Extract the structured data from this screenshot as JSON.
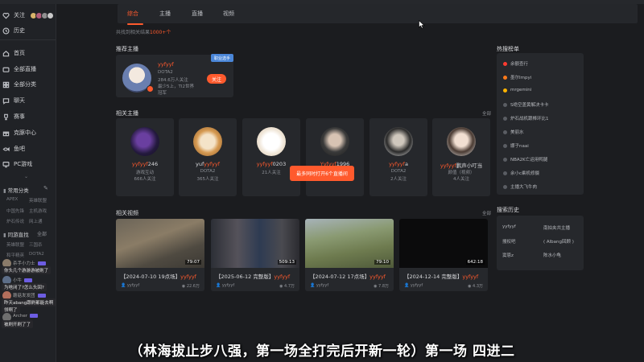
{
  "sidebar": {
    "nav": [
      {
        "label": "关注",
        "icon": "heart-icon"
      },
      {
        "label": "历史",
        "icon": "clock-icon"
      },
      {
        "label": "首页",
        "icon": "home-icon"
      },
      {
        "label": "全部直播",
        "icon": "tv-icon"
      },
      {
        "label": "全部分类",
        "icon": "grid-icon"
      },
      {
        "label": "聊天",
        "icon": "chat-icon"
      },
      {
        "label": "赛事",
        "icon": "trophy-icon"
      },
      {
        "label": "克豚中心",
        "icon": "gift-icon"
      },
      {
        "label": "鱼吧",
        "icon": "fish-icon"
      },
      {
        "label": "PC游戏",
        "icon": "monitor-icon"
      }
    ],
    "common_category_title": "常用分类",
    "common_categories": [
      "APEX",
      "英雄联盟",
      "中国先锋",
      "主机游戏",
      "炉石传说",
      "网上通"
    ],
    "same_category_title": "同游直找",
    "same_category_all": "全部",
    "same_categories": [
      "英雄联盟",
      "三国杀",
      "和平精英",
      "DOTA2",
      "绝地求生",
      "APEX"
    ],
    "chat": [
      {
        "name": "杀手小力士",
        "text": "你头几个游游游被刷了"
      },
      {
        "name": "小牛",
        "text": "路路国了"
      },
      {
        "name": "",
        "text": "为啥闭了?怎么头回?"
      },
      {
        "name": "蘑菇发发团",
        "text": "昨天abang跟刷都能去啊"
      },
      {
        "name": "",
        "text": "领啊了"
      },
      {
        "name": "Archer",
        "text": "被刷开刷了了"
      }
    ]
  },
  "tabs": {
    "items": [
      "综合",
      "主播",
      "直播",
      "视频"
    ],
    "active": "综合"
  },
  "result_count": {
    "prefix": "共找到相关结果",
    "count": "1000+",
    "suffix": "个"
  },
  "recommend": {
    "title": "推荐主播",
    "name": "yyfyyf",
    "category": "DOTA2",
    "fans": "284.6万人关注",
    "desc_1": "最少5上，TI2世界",
    "desc_2": "冠军",
    "tag": "职业选手",
    "follow_label": "关注"
  },
  "related_anchors": {
    "title": "相关主播",
    "all": "全部",
    "overlay": "最多同时打开6个直播间",
    "items": [
      {
        "name_hl": "yyfyyf",
        "name_rest": "246",
        "sub1": "游戏互动",
        "sub2": "666人关注"
      },
      {
        "name_pre": "yuf",
        "name_hl": "yyfyyf",
        "sub1": "DOTA2",
        "sub2": "365人关注"
      },
      {
        "name_hl": "yyfyyf",
        "name_rest": "0203",
        "sub1": "21人关注",
        "sub2": ""
      },
      {
        "name_hl": "Yyfyyf",
        "name_rest": "1996",
        "sub1": "",
        "sub2": ""
      },
      {
        "name_hl": "yyfyyf",
        "name_rest": "a",
        "sub1": "DOTA2",
        "sub2": "2人关注"
      },
      {
        "name_hl": "yyfyyf",
        "name_rest": "鹏声小叮当",
        "sub1": "颜值（视频）",
        "sub2": "4人关注"
      }
    ]
  },
  "related_videos": {
    "title": "相关视频",
    "all": "全部",
    "items": [
      {
        "title_pre": "【2024-07-10 19点场】",
        "title_hl": "yyfyyf",
        "author": "yyfyyf",
        "views": "22.6万",
        "duration": "79:07"
      },
      {
        "title_pre": "【2025-06-12 完整版】",
        "title_hl": "yyfyyf",
        "author": "yyfyyf",
        "views": "4.7万",
        "duration": "509:13"
      },
      {
        "title_pre": "【2024-07-12 17点场】",
        "title_hl": "yyfyyf",
        "author": "yyfyyf",
        "views": "7.8万",
        "duration": "79:10"
      },
      {
        "title_pre": "【2024-12-14 完整版】",
        "title_hl": "yyfyyf",
        "author": "yyfyyf",
        "views": "4.3万",
        "duration": "642:18"
      }
    ]
  },
  "hot_list": {
    "title": "热搜榜单",
    "items": [
      {
        "label": "余额查行",
        "color": "#ff3b30"
      },
      {
        "label": "墨尔Impyi",
        "color": "#ff7a1a"
      },
      {
        "label": "mrgemini",
        "color": "#ffb400"
      },
      {
        "label": "S绝空盖黄解决卡卡",
        "color": "#5a5d63"
      },
      {
        "label": "炉石战机跟棒环比1",
        "color": "#5a5d63"
      },
      {
        "label": "美丽水",
        "color": "#5a5d63"
      },
      {
        "label": "娜子naai",
        "color": "#5a5d63"
      },
      {
        "label": "NBA2K亡运用鸭腿",
        "color": "#5a5d63"
      },
      {
        "label": "余小c乘机修摄",
        "color": "#5a5d63"
      },
      {
        "label": "主播大飞牛肉",
        "color": "#5a5d63"
      }
    ]
  },
  "search_history": {
    "title": "搜索历史",
    "items": [
      "yyfyyf",
      "南拍夹共主播",
      "搜权吧",
      "( Albang回顾 )",
      "窦恩z",
      "陈水小龟"
    ]
  },
  "caption": "（林海拔止步八强，第一场全打完后开新一轮）第一场 四进二"
}
